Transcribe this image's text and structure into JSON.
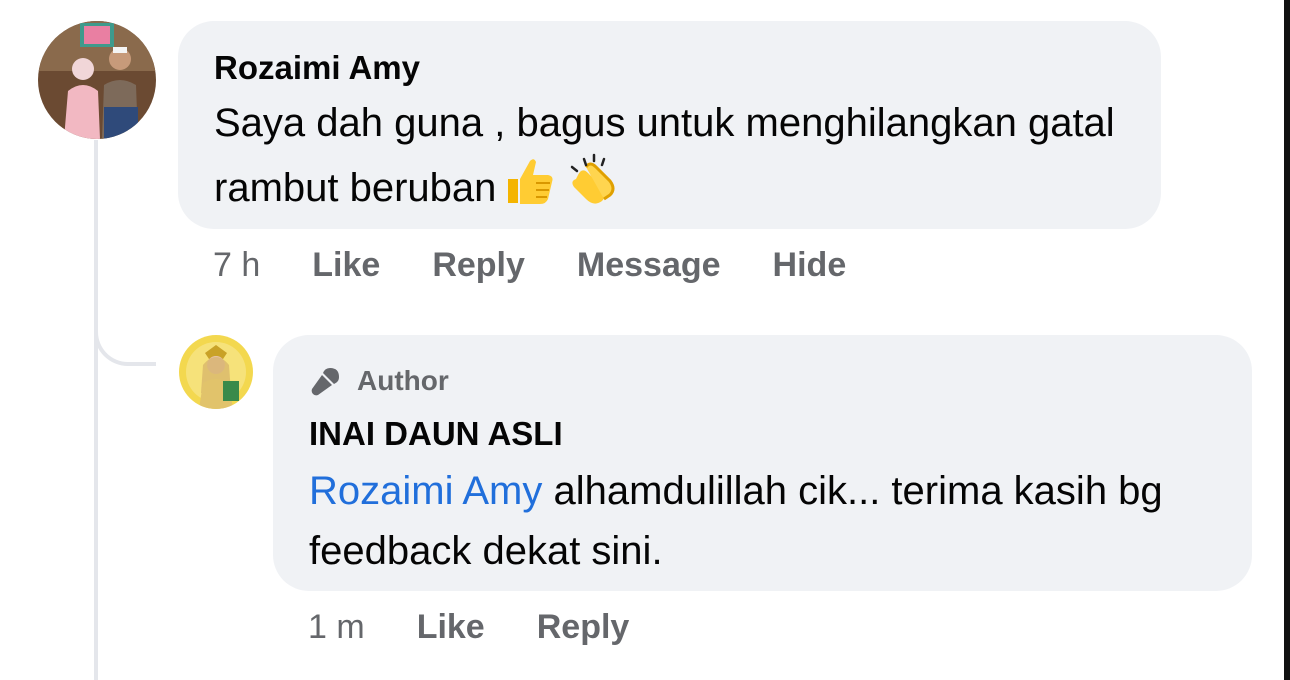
{
  "comment": {
    "author": "Rozaimi Amy",
    "text": "Saya dah guna , bagus untuk menghilangkan gatal rambut beruban",
    "emojis": [
      "thumbs-up-icon",
      "clapping-hands-icon"
    ],
    "time": "7 h",
    "actions": [
      "Like",
      "Reply",
      "Message",
      "Hide"
    ]
  },
  "reply": {
    "badge": "Author",
    "badge_icon": "microphone-icon",
    "author": "INAI DAUN ASLI",
    "mention": "Rozaimi Amy",
    "text": " alhamdulillah cik... terima kasih bg feedback dekat sini.",
    "time": "1 m",
    "actions": [
      "Like",
      "Reply"
    ]
  },
  "colors": {
    "bubble": "#f0f2f5",
    "mention": "#216fdb",
    "secondary_text": "#65676b",
    "thread_line": "#e4e6eb"
  }
}
